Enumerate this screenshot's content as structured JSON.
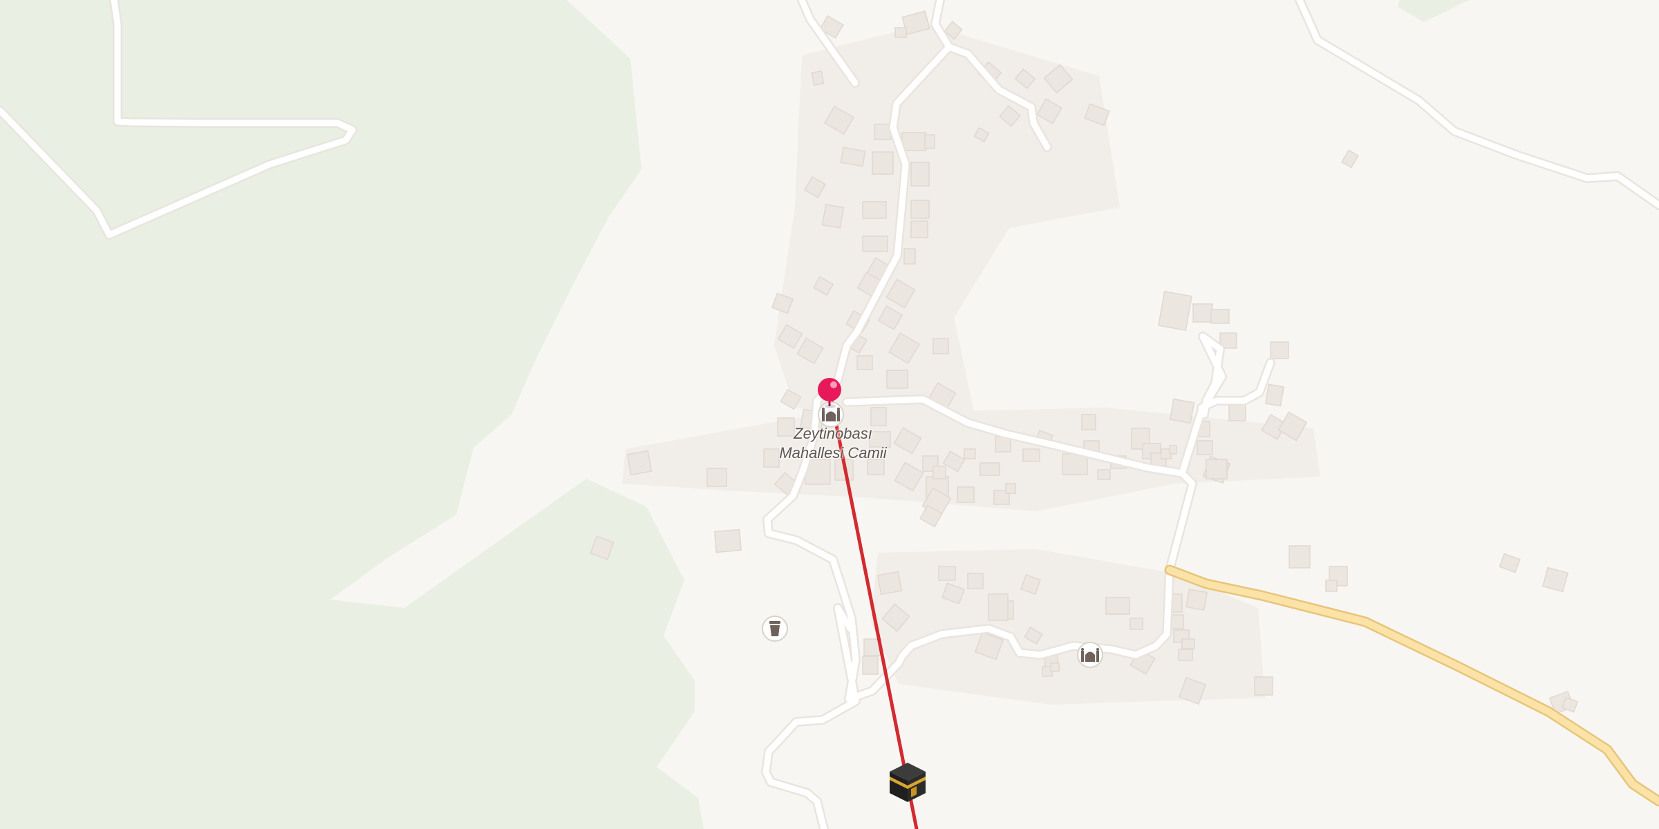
{
  "map": {
    "colors": {
      "background": "#f8f6f2",
      "forest": "#e9efe2",
      "road": "#ffffff",
      "secondary_road": "#fbe3a7",
      "secondary_road_casing": "#e8c47a",
      "building": "#ece6e0",
      "qibla_line": "#d32a2f",
      "location_pin": "#e8195a",
      "poi_icon": "#6e625a"
    },
    "location_pin": {
      "icon": "location-pin-icon"
    },
    "destination_marker": {
      "icon": "kaaba-icon"
    },
    "direction_line": {
      "type": "qibla-direction-line"
    },
    "pois": [
      {
        "icon": "mosque-icon",
        "name_line1": "Zeytinobası",
        "name_line2": "Mahallesi Camii"
      },
      {
        "icon": "mosque-icon",
        "name_line1": "",
        "name_line2": ""
      },
      {
        "icon": "waste-basket-icon",
        "name_line1": "",
        "name_line2": ""
      }
    ]
  }
}
